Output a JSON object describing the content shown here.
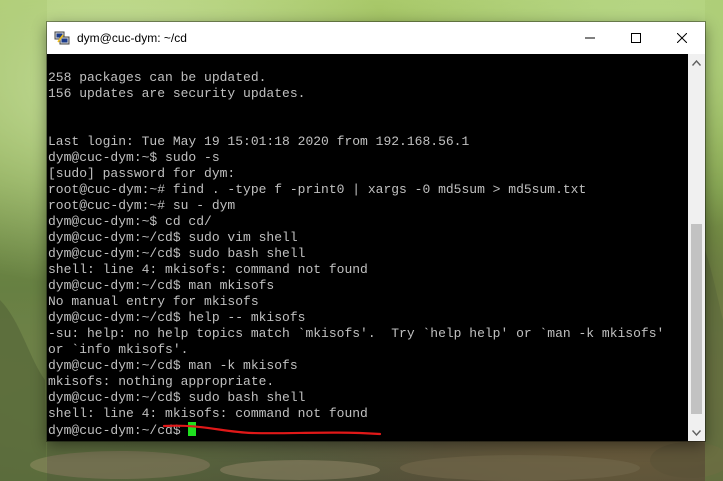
{
  "window": {
    "title": "dym@cuc-dym: ~/cd",
    "minimize_icon": "minimize-icon",
    "maximize_icon": "maximize-icon",
    "close_icon": "close-icon"
  },
  "terminal": {
    "lines": [
      "258 packages can be updated.",
      "156 updates are security updates.",
      "",
      "",
      "Last login: Tue May 19 15:01:18 2020 from 192.168.56.1",
      "dym@cuc-dym:~$ sudo -s",
      "[sudo] password for dym:",
      "root@cuc-dym:~# find . -type f -print0 | xargs -0 md5sum > md5sum.txt",
      "root@cuc-dym:~# su - dym",
      "dym@cuc-dym:~$ cd cd/",
      "dym@cuc-dym:~/cd$ sudo vim shell",
      "dym@cuc-dym:~/cd$ sudo bash shell",
      "shell: line 4: mkisofs: command not found",
      "dym@cuc-dym:~/cd$ man mkisofs",
      "No manual entry for mkisofs",
      "dym@cuc-dym:~/cd$ help -- mkisofs",
      "-su: help: no help topics match `mkisofs'.  Try `help help' or `man -k mkisofs'",
      "or `info mkisofs'.",
      "dym@cuc-dym:~/cd$ man -k mkisofs",
      "mkisofs: nothing appropriate.",
      "dym@cuc-dym:~/cd$ sudo bash shell",
      "shell: line 4: mkisofs: command not found"
    ],
    "prompt": "dym@cuc-dym:~/cd$ "
  },
  "colors": {
    "terminal_bg": "#000000",
    "terminal_text": "#c0c0c0",
    "cursor": "#1fe01f",
    "annotation": "#e01818"
  }
}
